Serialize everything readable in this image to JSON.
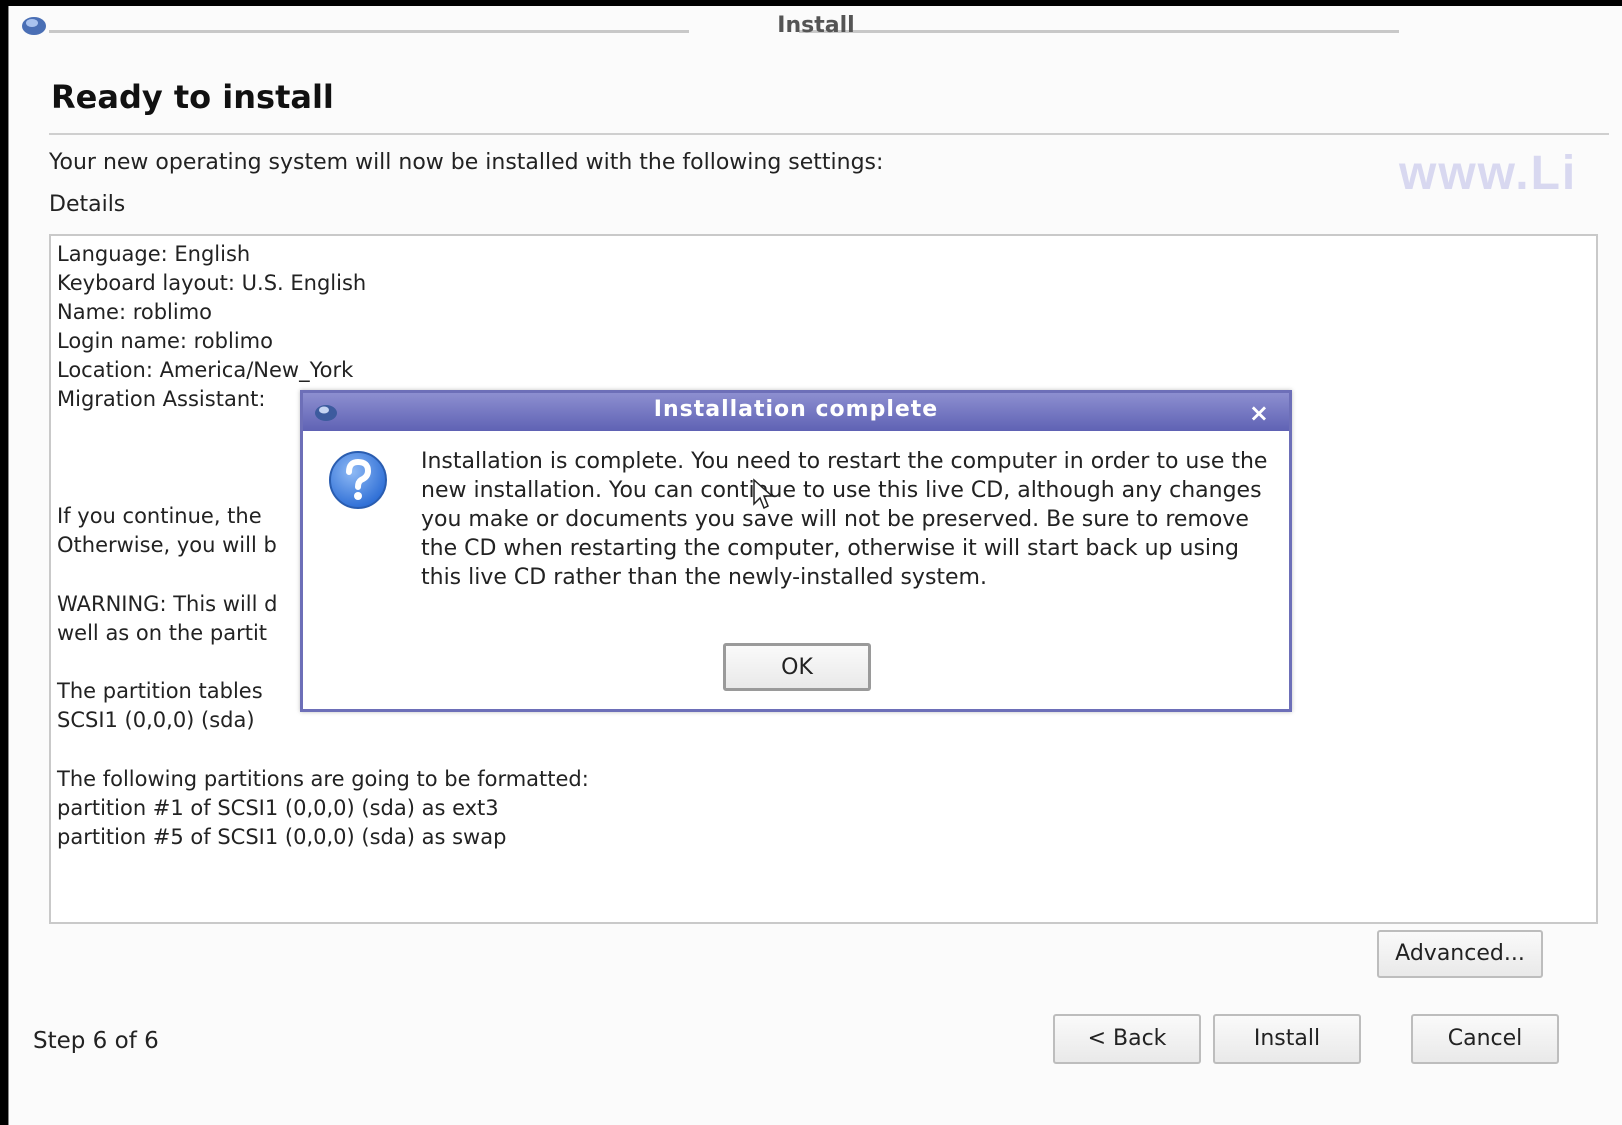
{
  "window": {
    "title": "Install",
    "heading": "Ready to install",
    "intro": "Your new operating system will now be installed with the following settings:",
    "details_label": "Details",
    "watermark": "www.Li",
    "details_lines": [
      " Language: English",
      "Keyboard layout: U.S. English",
      "Name: roblimo",
      "Login name: roblimo",
      "Location: America/New_York",
      "Migration Assistant:",
      "If you continue, the",
      "Otherwise, you will b",
      "WARNING: This will d",
      "well as on the partit",
      "The partition tables",
      "SCSI1 (0,0,0) (sda)",
      "The following partitions are going to be formatted:",
      "partition #1 of SCSI1 (0,0,0) (sda) as ext3",
      "partition #5 of SCSI1 (0,0,0) (sda) as swap"
    ],
    "advanced_label": "Advanced...",
    "step_label": "Step 6 of 6",
    "back_label": "< Back",
    "install_label": "Install",
    "cancel_label": "Cancel"
  },
  "dialog": {
    "title": "Installation complete",
    "close": "×",
    "message": "Installation is complete. You need to restart the computer in order to use the new installation. You can continue to use this live CD, although any changes you make or documents you save will not be preserved. Be sure to remove the CD when restarting the computer, otherwise it will start back up using this live CD rather than the newly-installed system.",
    "ok_label": "OK"
  },
  "icons": {
    "app": "installer-icon",
    "question": "question-icon",
    "cursor": "mouse-cursor-icon"
  },
  "colors": {
    "dialog_title_bar": "#6d6fb8",
    "question_icon": "#3b7de0"
  }
}
